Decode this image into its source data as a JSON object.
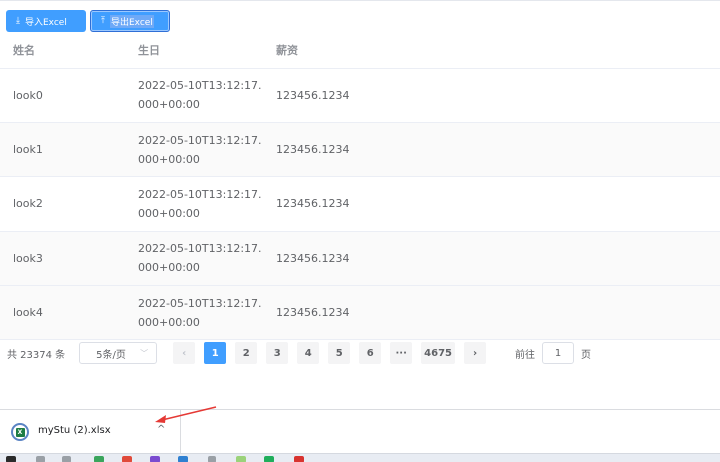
{
  "toolbar": {
    "import_label": "导入Excel",
    "export_label": "导出Excel",
    "import_icon": "download-icon",
    "export_icon": "upload-icon"
  },
  "table": {
    "headers": [
      "姓名",
      "生日",
      "薪资"
    ],
    "rows": [
      {
        "name": "look0",
        "birthday": "2022-05-10T13:12:17.000+00:00",
        "salary": "123456.1234"
      },
      {
        "name": "look1",
        "birthday": "2022-05-10T13:12:17.000+00:00",
        "salary": "123456.1234"
      },
      {
        "name": "look2",
        "birthday": "2022-05-10T13:12:17.000+00:00",
        "salary": "123456.1234"
      },
      {
        "name": "look3",
        "birthday": "2022-05-10T13:12:17.000+00:00",
        "salary": "123456.1234"
      },
      {
        "name": "look4",
        "birthday": "2022-05-10T13:12:17.000+00:00",
        "salary": "123456.1234"
      }
    ]
  },
  "pagination": {
    "total_text": "共 23374 条",
    "page_size": "5条/页",
    "prev_icon": "chevron-left-icon",
    "pages": [
      "1",
      "2",
      "3",
      "4",
      "5",
      "6"
    ],
    "current_page": "1",
    "more": "···",
    "last_page": "4675",
    "next_icon": "chevron-right-icon",
    "goto_label": "前往",
    "goto_value": "1",
    "goto_suffix": "页"
  },
  "download_bar": {
    "file_name": "myStu (2).xlsx",
    "menu_icon": "chevron-up-icon"
  },
  "colors": {
    "primary": "#409eff",
    "annotation_arrow": "#e53935"
  }
}
